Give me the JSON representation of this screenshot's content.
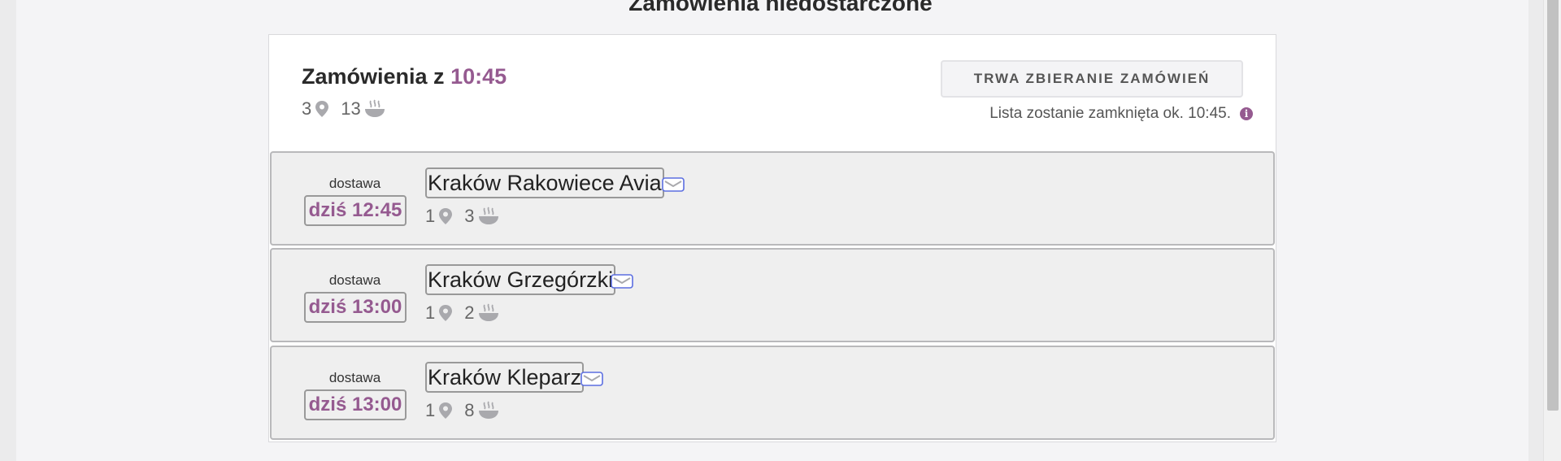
{
  "page": {
    "title": "Zamówienia niedostarczone"
  },
  "batch": {
    "title_prefix": "Zamówienia z",
    "time": "10:45",
    "locations_count": "3",
    "meals_count": "13",
    "status_button_label": "TRWA ZBIERANIE ZAMÓWIEŃ",
    "status_note": "Lista zostanie zamknięta ok. 10:45.",
    "info_icon": "i"
  },
  "routes": [
    {
      "type": "dostawa",
      "time": "dziś 12:45",
      "name": "Kraków Rakowiece Avia",
      "locations_count": "1",
      "meals_count": "3"
    },
    {
      "type": "dostawa",
      "time": "dziś 13:00",
      "name": "Kraków Grzegórzki",
      "locations_count": "1",
      "meals_count": "2"
    },
    {
      "type": "dostawa",
      "time": "dziś 13:00",
      "name": "Kraków Kleparz",
      "locations_count": "1",
      "meals_count": "8"
    }
  ],
  "colors": {
    "accent": "#955a90",
    "mail_icon": "#5b6ee1",
    "icon_gray": "#a9a9ad"
  },
  "icons": {
    "location": "map-pin-icon",
    "meals": "soup-bowl-icon",
    "message": "envelope-icon",
    "info": "info-circle-icon"
  }
}
